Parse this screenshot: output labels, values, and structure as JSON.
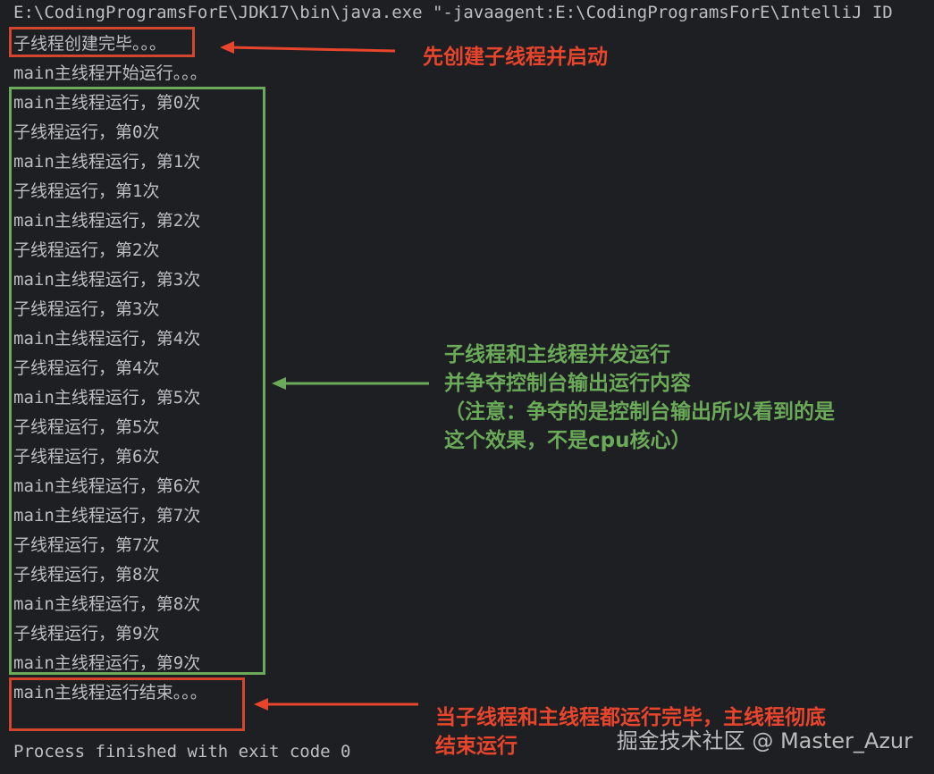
{
  "console": {
    "command_line": "E:\\CodingProgramsForE\\JDK17\\bin\\java.exe \"-javaagent:E:\\CodingProgramsForE\\IntelliJ ID",
    "lines": [
      "子线程创建完毕。。。",
      "main主线程开始运行。。。",
      "main主线程运行，第0次",
      "子线程运行，第0次",
      "main主线程运行，第1次",
      "子线程运行，第1次",
      "main主线程运行，第2次",
      "子线程运行，第2次",
      "main主线程运行，第3次",
      "子线程运行，第3次",
      "main主线程运行，第4次",
      "子线程运行，第4次",
      "main主线程运行，第5次",
      "子线程运行，第5次",
      "子线程运行，第6次",
      "main主线程运行，第6次",
      "main主线程运行，第7次",
      "子线程运行，第7次",
      "子线程运行，第8次",
      "main主线程运行，第8次",
      "子线程运行，第9次",
      "main主线程运行，第9次",
      "main主线程运行结束。。。",
      "",
      "Process finished with exit code 0"
    ]
  },
  "annotations": {
    "top": "先创建子线程并启动",
    "middle": "子线程和主线程并发运行\n并争夺控制台输出运行内容\n（注意：争夺的是控制台输出所以看到的是\n这个效果，不是cpu核心）",
    "bottom": "当子线程和主线程都运行完毕，主线程彻底\n结束运行"
  },
  "watermark": "掘金技术社区 @ Master_Azur",
  "colors": {
    "background": "#1e1f22",
    "console_text": "#bcbec4",
    "red": "#e8452c",
    "green": "#6aaa58"
  }
}
